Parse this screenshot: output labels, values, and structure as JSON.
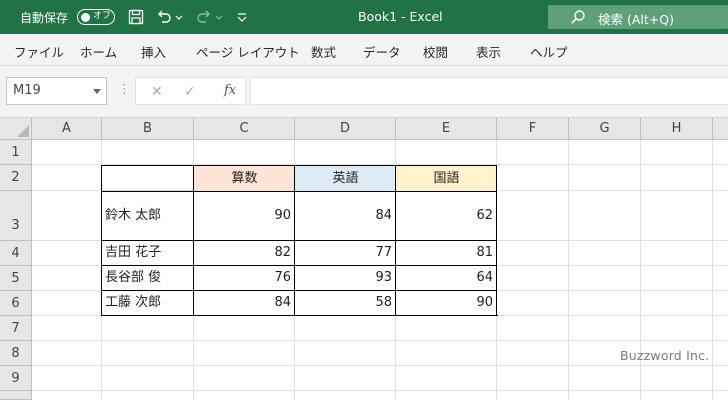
{
  "titlebar": {
    "autosave_label": "自動保存",
    "autosave_state": "オフ",
    "title": "Book1  -  Excel",
    "search_label": "検索 (Alt+Q)",
    "background": "#217346"
  },
  "menu": [
    "ファイル",
    "ホーム",
    "挿入",
    "ページ レイアウト",
    "数式",
    "データ",
    "校閲",
    "表示",
    "ヘルプ"
  ],
  "formula_bar": {
    "name_box": "M19",
    "fx": "fx",
    "value": ""
  },
  "sheet": {
    "columns": [
      "A",
      "B",
      "C",
      "D",
      "E",
      "F",
      "G",
      "H"
    ],
    "rows": [
      "1",
      "2",
      "3",
      "4",
      "5",
      "6",
      "7",
      "8",
      "9"
    ],
    "table": {
      "headers": [
        {
          "label": "算数",
          "color": "#fce4d6"
        },
        {
          "label": "英語",
          "color": "#ddebf7"
        },
        {
          "label": "国語",
          "color": "#fff2cc"
        }
      ],
      "records": [
        {
          "name": "鈴木 太郎",
          "scores": [
            "90",
            "84",
            "62"
          ]
        },
        {
          "name": "吉田 花子",
          "scores": [
            "82",
            "77",
            "81"
          ]
        },
        {
          "name": "長谷部 俊",
          "scores": [
            "76",
            "93",
            "64"
          ]
        },
        {
          "name": "工藤 次郎",
          "scores": [
            "84",
            "58",
            "90"
          ]
        }
      ]
    }
  },
  "watermark": "Buzzword Inc."
}
